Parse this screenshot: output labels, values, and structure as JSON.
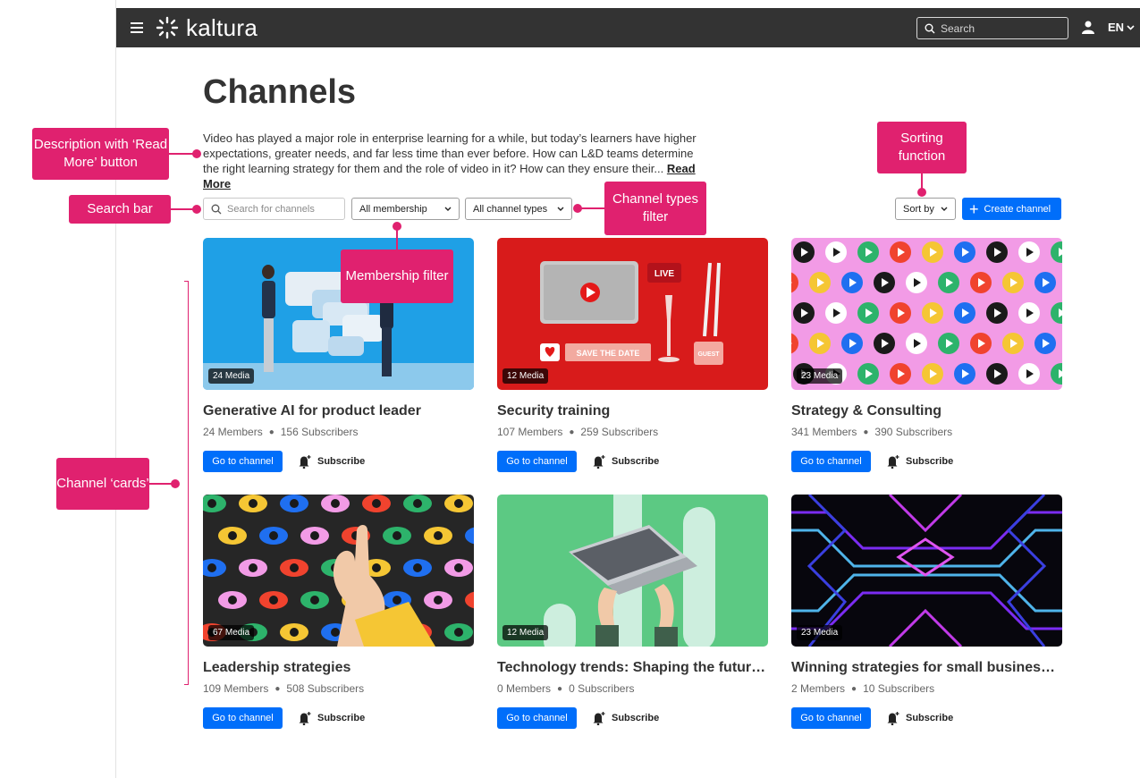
{
  "header": {
    "logo_text": "kaltura",
    "search_placeholder": "Search",
    "language": "EN"
  },
  "page": {
    "title": "Channels",
    "description": "Video has played a major role in enterprise learning for a while, but today’s learners have higher expectations, greater needs, and far less time than ever before. How can L&D teams determine the right learning strategy for them and the role of video in it? How can they ensure their...",
    "read_more": "Read More"
  },
  "toolbar": {
    "search_placeholder": "Search for channels",
    "membership_filter": "All membership",
    "type_filter": "All channel types",
    "sort_label": "Sort by",
    "create_label": "Create channel"
  },
  "card_labels": {
    "go": "Go to channel",
    "subscribe": "Subscribe"
  },
  "channels": [
    {
      "title": "Generative AI for product leader",
      "members": "24 Members",
      "subscribers": "156 Subscribers",
      "media": "24 Media"
    },
    {
      "title": "Security training",
      "members": "107 Members",
      "subscribers": "259 Subscribers",
      "media": "12 Media"
    },
    {
      "title": "Strategy & Consulting",
      "members": "341 Members",
      "subscribers": "390 Subscribers",
      "media": "23 Media"
    },
    {
      "title": "Leadership strategies",
      "members": "109 Members",
      "subscribers": "508 Subscribers",
      "media": "67 Media"
    },
    {
      "title": "Technology trends: Shaping the future en...",
      "members": "0 Members",
      "subscribers": "0 Subscribers",
      "media": "12 Media"
    },
    {
      "title": "Winning strategies for small businesses",
      "members": "2 Members",
      "subscribers": "10 Subscribers",
      "media": "23 Media"
    }
  ],
  "thumb_text": {
    "live": "LIVE",
    "save_the_date": "SAVE THE DATE",
    "guest": "GUEST"
  },
  "annotations": {
    "description": "Description with ‘Read More’ button",
    "search_bar": "Search bar",
    "channel_cards": "Channel ‘cards’",
    "membership_filter": "Membership filter",
    "channel_types_filter": "Channel types filter",
    "sorting_function": "Sorting function"
  },
  "colors": {
    "accent": "#006efa",
    "annotation": "#e0216f",
    "topbar": "#333333"
  }
}
